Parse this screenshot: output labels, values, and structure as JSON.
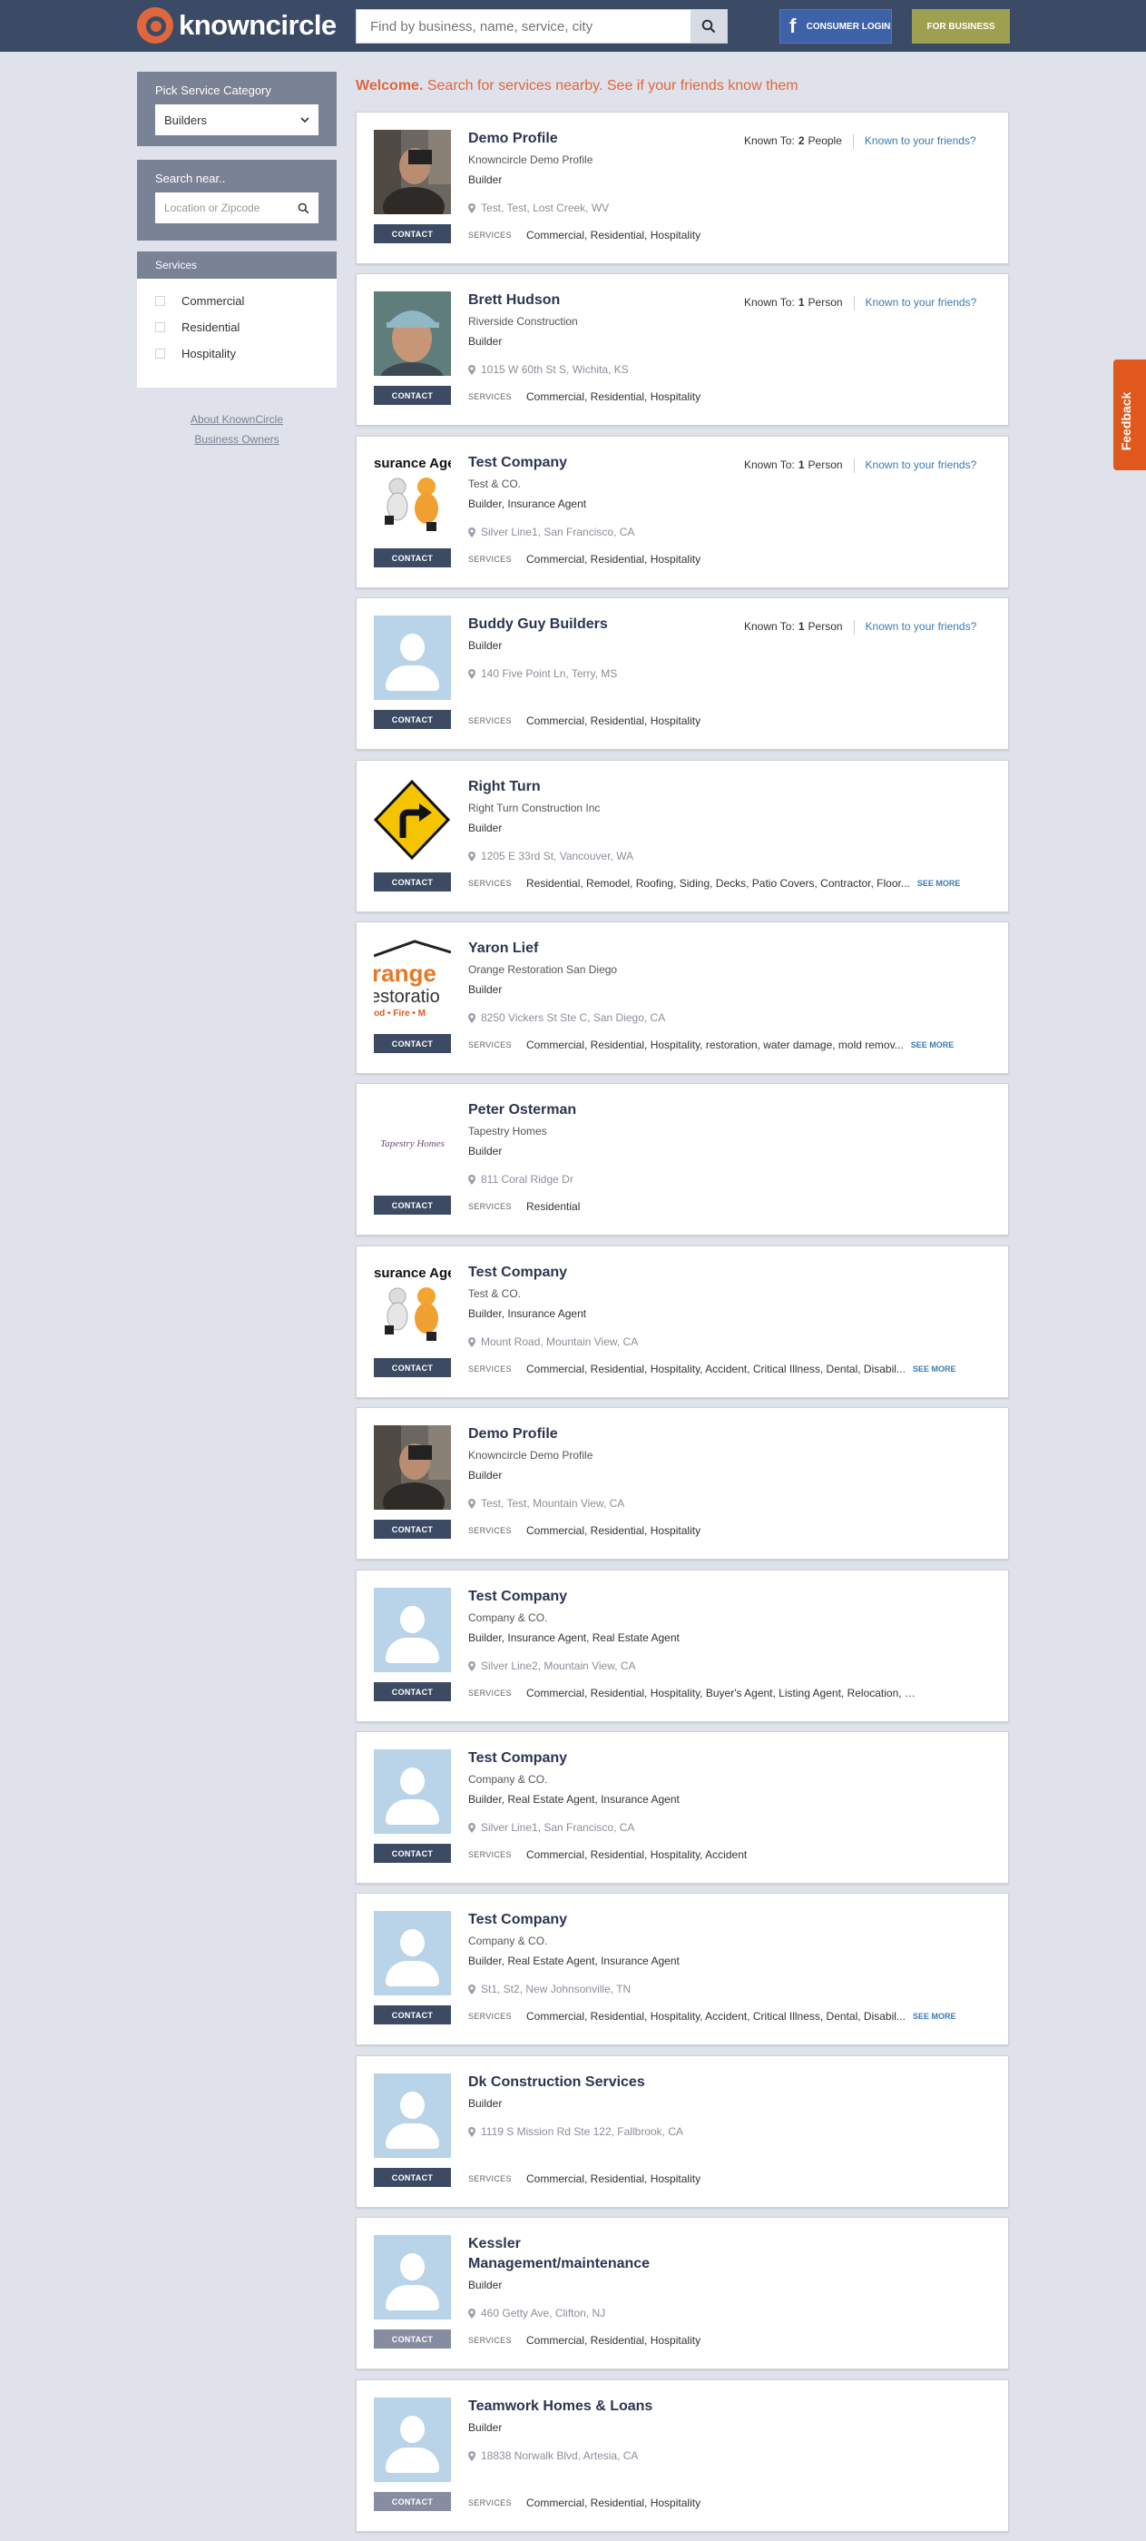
{
  "header": {
    "logo_text": "knowncircle",
    "search_placeholder": "Find by business, name, service, city",
    "consumer_login": "CONSUMER LOGIN",
    "for_business": "FOR BUSINESS"
  },
  "sidebar": {
    "category_label": "Pick Service Category",
    "category_value": "Builders",
    "search_near_label": "Search near..",
    "location_placeholder": "Location or Zipcode",
    "services_header": "Services",
    "services": [
      "Commercial",
      "Residential",
      "Hospitality"
    ],
    "about_link": "About KnownCircle",
    "owners_link": "Business Owners"
  },
  "welcome": {
    "bold": "Welcome.",
    "text": "Search for services nearby. See if your friends know them"
  },
  "labels": {
    "contact": "CONTACT",
    "services": "SERVICES",
    "see_more": "SEE MORE",
    "known_to": "Known To:",
    "known_link": "Known to your friends?"
  },
  "results": [
    {
      "name": "Demo Profile",
      "company": "Knowncircle Demo Profile",
      "category": "Builder",
      "location": "Test, Test, Lost Creek, WV",
      "services": "Commercial, Residential, Hospitality",
      "known_count": "2",
      "known_unit": "People",
      "photo": "demo-photo"
    },
    {
      "name": "Brett Hudson",
      "company": "Riverside Construction",
      "category": "Builder",
      "location": "1015 W 60th St S, Wichita, KS",
      "services": "Commercial, Residential, Hospitality",
      "known_count": "1",
      "known_unit": "Person",
      "photo": "brett-photo"
    },
    {
      "name": "Test Company",
      "company": "Test & CO.",
      "category": "Builder, Insurance Agent",
      "location": "Silver Line1, San Francisco, CA",
      "services": "Commercial, Residential, Hospitality",
      "known_count": "1",
      "known_unit": "Person",
      "photo": "insurance-logo",
      "photo_text": "surance Age"
    },
    {
      "name": "Buddy Guy Builders",
      "company": "",
      "category": "Builder",
      "location": "140 Five Point Ln, Terry, MS",
      "services": "Commercial, Residential, Hospitality",
      "known_count": "1",
      "known_unit": "Person",
      "photo": "placeholder"
    },
    {
      "name": "Right Turn",
      "company": "Right Turn Construction Inc",
      "category": "Builder",
      "location": "1205 E 33rd St, Vancouver, WA",
      "services": "Residential, Remodel, Roofing, Siding, Decks, Patio Covers, Contractor, Floor...",
      "see_more": true,
      "photo": "right-turn-sign"
    },
    {
      "name": "Yaron Lief",
      "company": "Orange Restoration San Diego",
      "category": "Builder",
      "location": "8250 Vickers St Ste C, San Diego, CA",
      "services": "Commercial, Residential, Hospitality, restoration, water damage, mold remov...",
      "see_more": true,
      "photo": "orange-logo",
      "photo_lines": [
        "range",
        "estoratio",
        "od • Fire • M"
      ]
    },
    {
      "name": "Peter Osterman",
      "company": "Tapestry Homes",
      "category": "Builder",
      "location": "811 Coral Ridge Dr",
      "services": "Residential",
      "photo": "tapestry-logo",
      "photo_text": "Tapestry Homes"
    },
    {
      "name": "Test Company",
      "company": "Test & CO.",
      "category": "Builder, Insurance Agent",
      "location": "Mount Road, Mountain View, CA",
      "services": "Commercial, Residential, Hospitality, Accident, Critical Illness, Dental, Disabil...",
      "see_more": true,
      "photo": "insurance-logo",
      "photo_text": "surance Age"
    },
    {
      "name": "Demo Profile",
      "company": "Knowncircle Demo Profile",
      "category": "Builder",
      "location": "Test, Test, Mountain View, CA",
      "services": "Commercial, Residential, Hospitality",
      "photo": "demo-photo"
    },
    {
      "name": "Test Company",
      "company": "Company & CO.",
      "category": "Builder, Insurance Agent, Real Estate Agent",
      "location": "Silver Line2, Mountain View, CA",
      "services": "Commercial, Residential, Hospitality, Buyer's Agent, Listing Agent, Relocation, Consulting",
      "photo": "placeholder"
    },
    {
      "name": "Test Company",
      "company": "Company & CO.",
      "category": "Builder, Real Estate Agent, Insurance Agent",
      "location": "Silver Line1, San Francisco, CA",
      "services": "Commercial, Residential, Hospitality, Accident",
      "photo": "placeholder"
    },
    {
      "name": "Test Company",
      "company": "Company & CO.",
      "category": "Builder, Real Estate Agent, Insurance Agent",
      "location": "St1, St2, New Johnsonville, TN",
      "services": "Commercial, Residential, Hospitality, Accident, Critical Illness, Dental, Disabil...",
      "see_more": true,
      "photo": "placeholder"
    },
    {
      "name": "Dk Construction Services",
      "company": "",
      "category": "Builder",
      "location": "1119 S Mission Rd Ste 122, Fallbrook, CA",
      "services": "Commercial, Residential, Hospitality",
      "photo": "placeholder"
    },
    {
      "name": "Kessler Management/maintenance",
      "company": "",
      "category": "Builder",
      "location": "460 Getty Ave, Clifton, NJ",
      "services": "Commercial, Residential, Hospitality",
      "photo": "placeholder",
      "contact_light": true
    },
    {
      "name": "Teamwork Homes & Loans",
      "company": "",
      "category": "Builder",
      "location": "18838 Norwalk Blvd, Artesia, CA",
      "services": "Commercial, Residential, Hospitality",
      "photo": "placeholder",
      "contact_light": true
    }
  ],
  "feedback_tab": "Feedback"
}
